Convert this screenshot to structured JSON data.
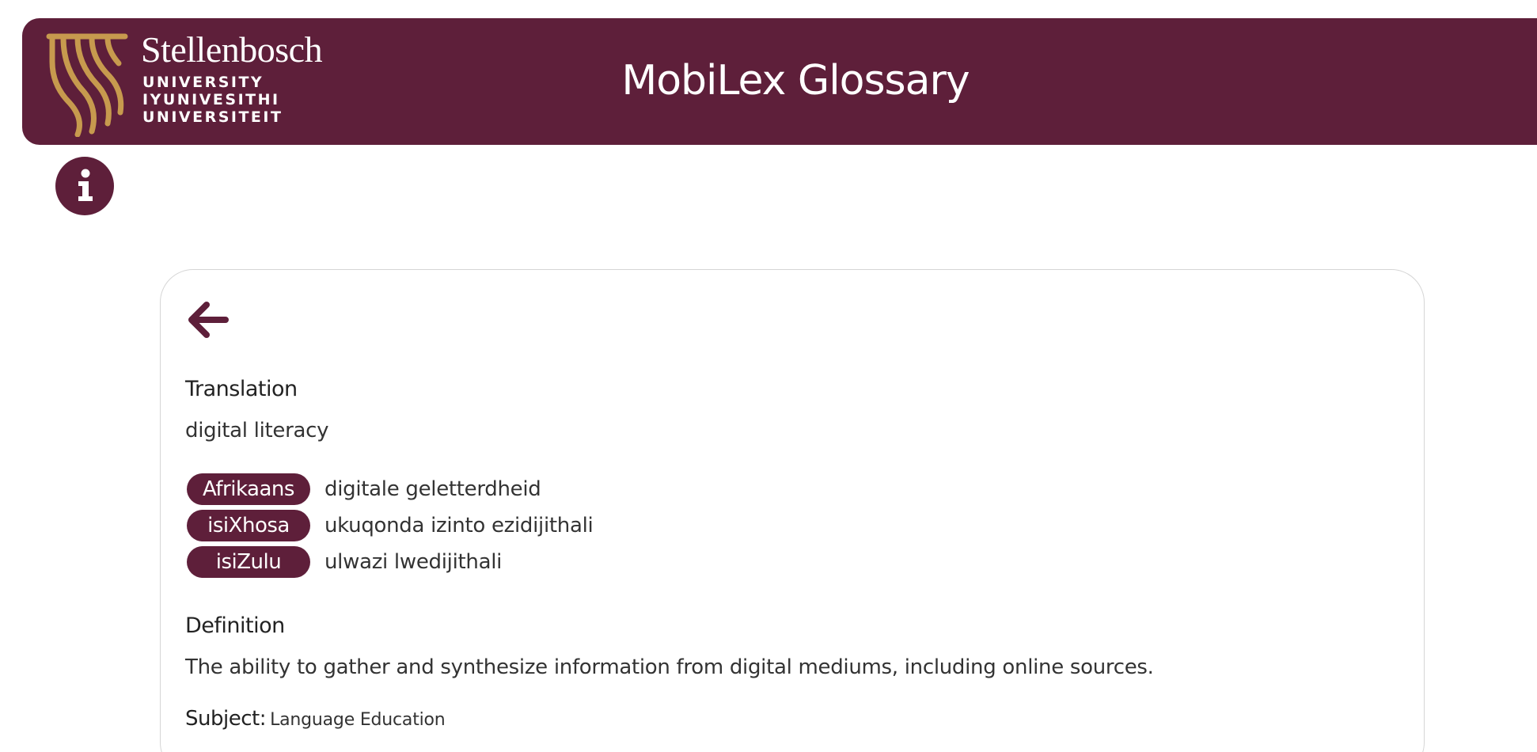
{
  "header": {
    "university": {
      "name": "Stellenbosch",
      "lines": [
        "UNIVERSITY",
        "IYUNIVESITHI",
        "UNIVERSITEIT"
      ]
    },
    "app_title": "MobiLex Glossary",
    "colors": {
      "brand": "#5e1f3a",
      "logo_gold": "#c79a4e"
    }
  },
  "info_button": {
    "icon": "info-icon"
  },
  "entry": {
    "back_icon": "arrow-left-icon",
    "translation_label": "Translation",
    "term": "digital literacy",
    "translations": [
      {
        "language": "Afrikaans",
        "term": "digitale geletterdheid"
      },
      {
        "language": "isiXhosa",
        "term": "ukuqonda izinto ezidijithali"
      },
      {
        "language": "isiZulu",
        "term": "ulwazi lwedijithali"
      }
    ],
    "definition_label": "Definition",
    "definition": "The ability to gather and synthesize information from digital mediums, including online sources.",
    "subject_label": "Subject:",
    "subject": "Language Education"
  }
}
